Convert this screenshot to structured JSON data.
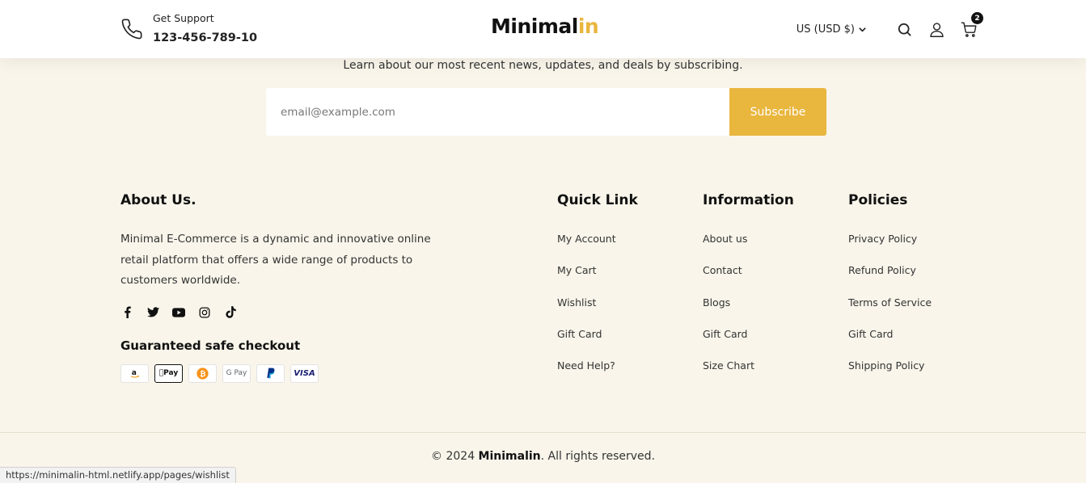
{
  "header": {
    "support_label": "Get Support",
    "support_number": "123-456-789-10",
    "logo_main": "Minimal",
    "logo_accent": "in",
    "currency": "US (USD $)",
    "cart_count": "2",
    "accent_color": "#e9b63e"
  },
  "newsletter": {
    "text": "Learn about our most recent news, updates, and deals by subscribing.",
    "email_placeholder": "email@example.com",
    "subscribe_label": "Subscribe"
  },
  "about": {
    "title": "About Us.",
    "description": "Minimal E-Commerce is a dynamic and innovative online retail platform that offers a wide range of products to customers worldwide.",
    "socials": [
      "facebook-icon",
      "twitter-icon",
      "youtube-icon",
      "instagram-icon",
      "tiktok-icon"
    ],
    "safe_checkout_title": "Guaranteed safe checkout",
    "payments": [
      "amazon",
      "apple-pay",
      "bitcoin",
      "google-pay",
      "paypal",
      "visa"
    ],
    "apple_pay_label": "Pay",
    "gpay_label": "G Pay",
    "visa_label": "VISA"
  },
  "quick_link": {
    "title": "Quick Link",
    "items": [
      "My Account",
      "My Cart",
      "Wishlist",
      "Gift Card",
      "Need Help?"
    ]
  },
  "information": {
    "title": "Information",
    "items": [
      "About us",
      "Contact",
      "Blogs",
      "Gift Card",
      "Size Chart"
    ]
  },
  "policies": {
    "title": "Policies",
    "items": [
      "Privacy Policy",
      "Refund Policy",
      "Terms of Service",
      "Gift Card",
      "Shipping Policy"
    ]
  },
  "footer": {
    "copyright_prefix": "© 2024 ",
    "copyright_brand": "Minimalin",
    "copyright_suffix": ". All rights reserved."
  },
  "status_bar": {
    "url": "https://minimalin-html.netlify.app/pages/wishlist"
  }
}
